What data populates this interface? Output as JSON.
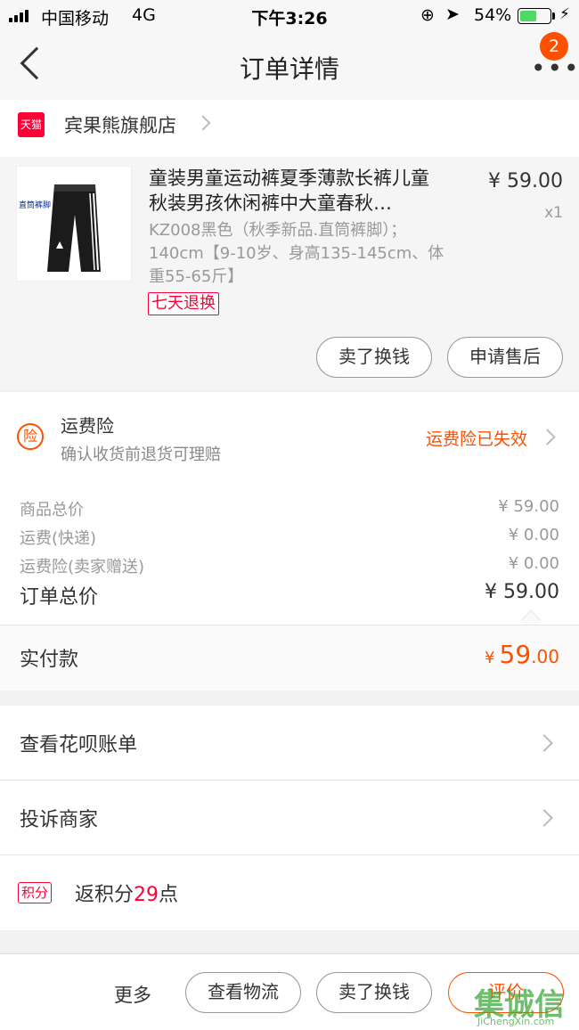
{
  "status_bar": {
    "carrier": "中国移动",
    "network": "4G",
    "time": "下午3:26",
    "battery_percent": "54%",
    "battery_level": 0.56,
    "icons": [
      "signal-icon",
      "location-lock-icon",
      "navigation-icon",
      "battery-icon",
      "charging-icon"
    ]
  },
  "nav": {
    "title": "订单详情",
    "back_icon": "chevron-left-icon",
    "more_icon": "more-dots-icon",
    "badge_count": "2"
  },
  "shop": {
    "icon_label": "天猫",
    "name": "宾果熊旗舰店"
  },
  "product": {
    "image_tag": "直筒裤脚",
    "name": "童装男童运动裤夏季薄款长裤儿童秋装男孩休闲裤中大童春秋…",
    "sku": "KZ008黑色（秋季新品.直筒裤脚）；140cm【9-10岁、身高135-145cm、体重55-65斤】",
    "price": "¥ 59.00",
    "qty": "x1",
    "return_tag": "七天退换",
    "buttons": {
      "sell": "卖了换钱",
      "after_sale": "申请售后"
    }
  },
  "insurance": {
    "icon_label": "险",
    "title": "运费险",
    "subtitle": "确认收货前退货可理赔",
    "status": "运费险已失效"
  },
  "summary": {
    "rows": [
      {
        "label": "商品总价",
        "value": "¥ 59.00"
      },
      {
        "label": "运费(快递)",
        "value": "¥ 0.00"
      },
      {
        "label": "运费险(卖家赠送)",
        "value": "¥ 0.00"
      }
    ],
    "total_label": "订单总价",
    "total_value": "¥ 59.00"
  },
  "paid": {
    "label": "实付款",
    "currency": "¥",
    "amount_int": "59",
    "amount_dec": ".00"
  },
  "links": {
    "huabei": "查看花呗账单",
    "complain": "投诉商家"
  },
  "points": {
    "badge": "积分",
    "prefix": "返积分",
    "num": "29",
    "suffix": "点"
  },
  "footer": {
    "more": "更多",
    "logistics": "查看物流",
    "sell": "卖了换钱",
    "review": "评价"
  },
  "watermark": {
    "main": "集诚信",
    "sub": "JiChengXin.com"
  },
  "colors": {
    "accent": "#ff5000",
    "tmall_red": "#ff0036",
    "background": "#f2f2f2"
  }
}
